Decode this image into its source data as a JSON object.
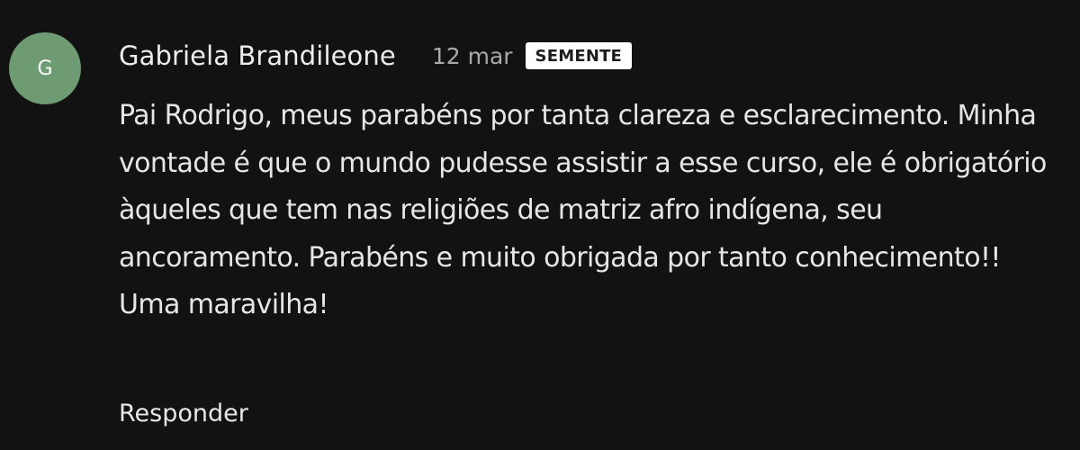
{
  "comment": {
    "avatar_initial": "G",
    "avatar_color": "#6e9b72",
    "author": "Gabriela Brandileone",
    "date": "12 mar",
    "badge": "SEMENTE",
    "text": "Pai Rodrigo, meus parabéns por tanta clareza e esclarecimento. Minha vontade é que o mundo pudesse assistir a esse curso, ele é obrigatório àqueles que tem nas religiões de matriz afro indígena, seu ancoramento. Parabéns e muito obrigada por tanto conhecimento!! Uma maravilha!",
    "reply_label": "Responder"
  }
}
